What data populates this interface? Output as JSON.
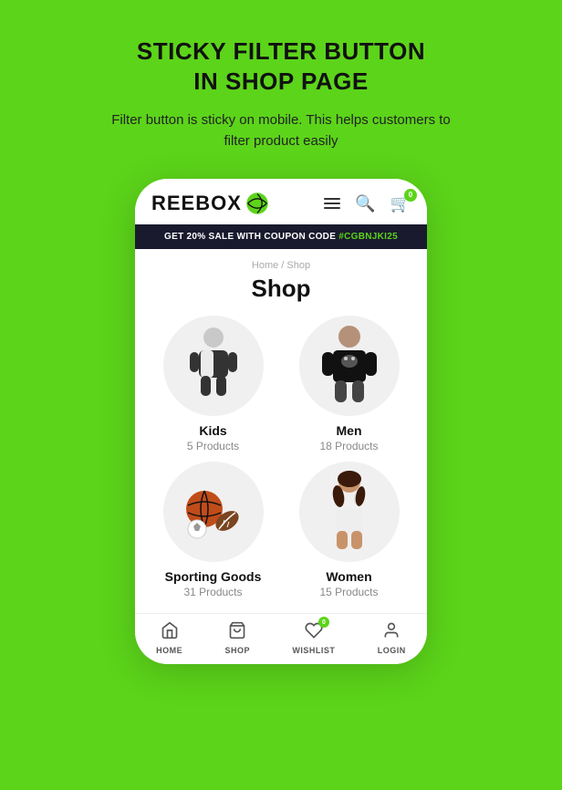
{
  "page": {
    "title_line1": "STICKY FILTER BUTTON",
    "title_line2": "IN SHOP PAGE",
    "description": "Filter button is sticky on mobile. This helps customers to filter product easily"
  },
  "app": {
    "logo_text": "REEBOX",
    "promo_banner": "GET 20% SALE WITH COUPON CODE ",
    "promo_code": "#CGBNJKI25",
    "breadcrumb": "Home  /  Shop",
    "shop_title": "Shop",
    "cart_badge": "0",
    "wishlist_badge": "0"
  },
  "categories": [
    {
      "name": "Kids",
      "count": "5 Products",
      "type": "kids"
    },
    {
      "name": "Men",
      "count": "18 Products",
      "type": "men"
    },
    {
      "name": "Sporting Goods",
      "count": "31 Products",
      "type": "sports"
    },
    {
      "name": "Women",
      "count": "15 Products",
      "type": "women"
    }
  ],
  "bottom_nav": [
    {
      "label": "HOME",
      "icon": "home"
    },
    {
      "label": "SHOP",
      "icon": "shop"
    },
    {
      "label": "WISHLIST",
      "icon": "heart"
    },
    {
      "label": "LOGIN",
      "icon": "user"
    }
  ]
}
